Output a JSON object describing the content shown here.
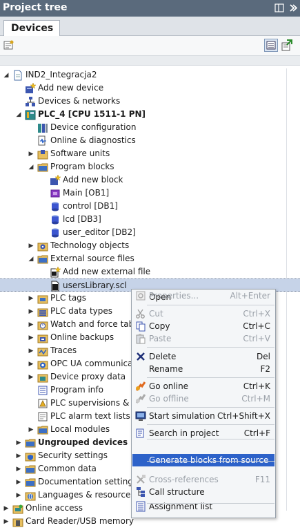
{
  "window": {
    "title": "Project tree"
  },
  "tabs": [
    {
      "label": "Devices"
    }
  ],
  "tree": [
    {
      "label": "IND2_Integracja2",
      "icon": "project-icon",
      "bold": false,
      "expander": "open"
    },
    {
      "label": "Add new device",
      "icon": "add-device-icon",
      "bold": false,
      "expander": "none"
    },
    {
      "label": "Devices & networks",
      "icon": "network-icon",
      "bold": false,
      "expander": "none"
    },
    {
      "label": "PLC_4 [CPU 1511-1 PN]",
      "icon": "plc-icon",
      "bold": true,
      "expander": "open"
    },
    {
      "label": "Device configuration",
      "icon": "device-config-icon",
      "bold": false,
      "expander": "none"
    },
    {
      "label": "Online & diagnostics",
      "icon": "diagnostics-icon",
      "bold": false,
      "expander": "none"
    },
    {
      "label": "Software units",
      "icon": "software-units-icon",
      "bold": false,
      "expander": "closed"
    },
    {
      "label": "Program blocks",
      "icon": "folder-icon",
      "bold": false,
      "expander": "open"
    },
    {
      "label": "Add new block",
      "icon": "add-block-icon",
      "bold": false,
      "expander": "none"
    },
    {
      "label": "Main [OB1]",
      "icon": "ob-block-icon",
      "bold": false,
      "expander": "none"
    },
    {
      "label": "control [DB1]",
      "icon": "db-block-icon",
      "bold": false,
      "expander": "none"
    },
    {
      "label": "lcd [DB3]",
      "icon": "db-block-icon",
      "bold": false,
      "expander": "none"
    },
    {
      "label": "user_editor [DB2]",
      "icon": "db-block-icon",
      "bold": false,
      "expander": "none"
    },
    {
      "label": "Technology objects",
      "icon": "technology-icon",
      "bold": false,
      "expander": "closed"
    },
    {
      "label": "External source files",
      "icon": "folder-icon",
      "bold": false,
      "expander": "open"
    },
    {
      "label": "Add new external file",
      "icon": "add-file-icon",
      "bold": false,
      "expander": "none"
    },
    {
      "label": "usersLibrary.scl",
      "icon": "file-icon",
      "bold": false,
      "expander": "none",
      "selected": true
    },
    {
      "label": "PLC tags",
      "icon": "tags-icon",
      "bold": false,
      "expander": "closed"
    },
    {
      "label": "PLC data types",
      "icon": "data-types-icon",
      "bold": false,
      "expander": "closed"
    },
    {
      "label": "Watch and force table",
      "icon": "watch-table-icon",
      "bold": false,
      "expander": "closed"
    },
    {
      "label": "Online backups",
      "icon": "backup-icon",
      "bold": false,
      "expander": "closed"
    },
    {
      "label": "Traces",
      "icon": "traces-icon",
      "bold": false,
      "expander": "closed"
    },
    {
      "label": "OPC UA communicatio",
      "icon": "opc-ua-icon",
      "bold": false,
      "expander": "closed"
    },
    {
      "label": "Device proxy data",
      "icon": "proxy-icon",
      "bold": false,
      "expander": "closed"
    },
    {
      "label": "Program info",
      "icon": "program-info-icon",
      "bold": false,
      "expander": "none"
    },
    {
      "label": "PLC supervisions & ala",
      "icon": "supervision-icon",
      "bold": false,
      "expander": "none"
    },
    {
      "label": "PLC alarm text lists",
      "icon": "alarm-text-icon",
      "bold": false,
      "expander": "none"
    },
    {
      "label": "Local modules",
      "icon": "folder-icon",
      "bold": false,
      "expander": "closed"
    },
    {
      "label": "Ungrouped devices",
      "icon": "folder-icon",
      "bold": true,
      "expander": "closed"
    },
    {
      "label": "Security settings",
      "icon": "security-icon",
      "bold": false,
      "expander": "closed"
    },
    {
      "label": "Common data",
      "icon": "folder-icon",
      "bold": false,
      "expander": "closed"
    },
    {
      "label": "Documentation settings",
      "icon": "folder-icon",
      "bold": false,
      "expander": "closed"
    },
    {
      "label": "Languages & resources",
      "icon": "languages-icon",
      "bold": false,
      "expander": "closed"
    },
    {
      "label": "Online access",
      "icon": "online-access-icon",
      "bold": false,
      "expander": "closed"
    },
    {
      "label": "Card Reader/USB memory",
      "icon": "card-reader-icon",
      "bold": false,
      "expander": "closed"
    }
  ],
  "context_menu": [
    {
      "label": "Open",
      "shortcut": "",
      "icon": "",
      "disabled": false
    },
    {
      "separator": true
    },
    {
      "label": "Cut",
      "shortcut": "Ctrl+X",
      "icon": "cut-icon",
      "disabled": true
    },
    {
      "label": "Copy",
      "shortcut": "Ctrl+C",
      "icon": "copy-icon",
      "disabled": false
    },
    {
      "label": "Paste",
      "shortcut": "Ctrl+V",
      "icon": "paste-icon",
      "disabled": true
    },
    {
      "separator": true
    },
    {
      "label": "Delete",
      "shortcut": "Del",
      "icon": "delete-icon",
      "disabled": false
    },
    {
      "label": "Rename",
      "shortcut": "F2",
      "icon": "",
      "disabled": false
    },
    {
      "separator": true
    },
    {
      "label": "Go online",
      "shortcut": "Ctrl+K",
      "icon": "go-online-icon",
      "disabled": false
    },
    {
      "label": "Go offline",
      "shortcut": "Ctrl+M",
      "icon": "go-offline-icon",
      "disabled": true
    },
    {
      "separator": true
    },
    {
      "label": "Start simulation",
      "shortcut": "Ctrl+Shift+X",
      "icon": "simulation-icon",
      "disabled": false
    },
    {
      "separator": true
    },
    {
      "label": "Search in project",
      "shortcut": "Ctrl+F",
      "icon": "search-icon",
      "disabled": false
    },
    {
      "separator": true
    },
    {
      "label": "Generate blocks from source",
      "shortcut": "",
      "icon": "",
      "disabled": false,
      "highlighted": true
    },
    {
      "separator": true
    },
    {
      "label": "Cross-references",
      "shortcut": "F11",
      "icon": "cross-references-icon",
      "disabled": true
    },
    {
      "label": "Call structure",
      "shortcut": "",
      "icon": "call-structure-icon",
      "disabled": false
    },
    {
      "label": "Assignment list",
      "shortcut": "",
      "icon": "assignment-list-icon",
      "disabled": false
    },
    {
      "separator": true
    },
    {
      "label": "Properties...",
      "shortcut": "Alt+Enter",
      "icon": "properties-icon",
      "disabled": true
    }
  ],
  "colors": {
    "titlebar": "#5a6a7c",
    "selection": "#c6d3e8",
    "menu_highlight": "#2d62c9"
  }
}
